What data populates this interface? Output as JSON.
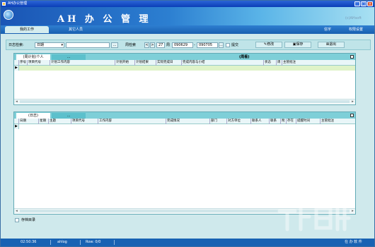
{
  "window": {
    "title": "AH办公管理"
  },
  "banner": {
    "title": "AH 办 公 管 理",
    "subtitle": "(c)AHsoft"
  },
  "nav": {
    "tabs": [
      "我的工作",
      "其它人员"
    ],
    "right": [
      "信宇",
      "权限设置"
    ]
  },
  "toolbar": {
    "search_label": "日志检索:",
    "search_type": "日期",
    "week_label": "周检索",
    "week_value": "27",
    "week_unit": "周",
    "date_from": "090629",
    "date_to": "090705",
    "submit_label": "提交",
    "edit_label": "修改",
    "save_label": "保存",
    "exit_label": "退出"
  },
  "plan_panel": {
    "tabs": [
      "(周计划)个人",
      "..."
    ],
    "title": "(周看)",
    "columns": [
      "序号",
      "项目代号",
      "计划工作内容",
      "计划开始",
      "计划结果",
      "实际完成日",
      "完成内容与小结",
      "状态",
      "周",
      "主管批注"
    ]
  },
  "log_panel": {
    "tabs": [
      "(日志)",
      "..."
    ],
    "columns": [
      "日期",
      "星期",
      "主题",
      "项目代号",
      "工作内容",
      "完成情况",
      "部门",
      "对方单位",
      "联系人",
      "联系",
      "附",
      "存在",
      "提醒时间",
      "主管批注"
    ]
  },
  "bottom": {
    "checkbox_label": "存档目录"
  },
  "status": {
    "time": "02:50:36",
    "user": "ahlog",
    "rows": "Row: 0/0",
    "right": "在 办 软 件"
  }
}
